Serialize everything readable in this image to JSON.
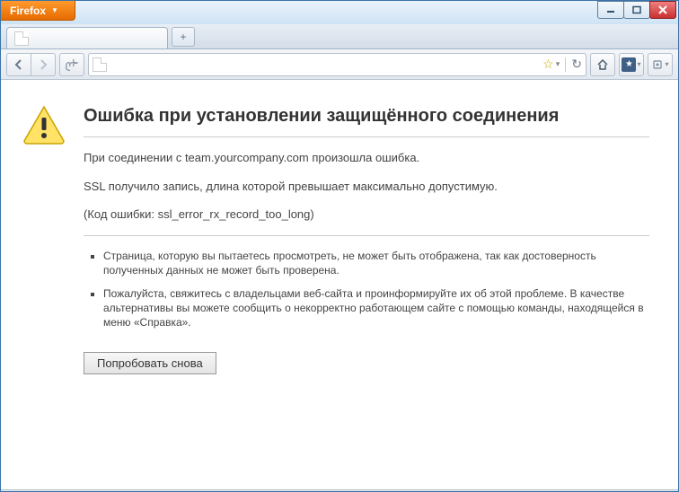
{
  "window": {
    "app_button": "Firefox",
    "tab_title": "",
    "controls": {
      "minimize": "–",
      "maximize": "□",
      "close": "×"
    }
  },
  "toolbar": {
    "back": "‹",
    "forward": "›",
    "url_value": "",
    "star": "★",
    "reload": "↻",
    "home": "⌂",
    "bookmarks": "★",
    "extensions": "⚙"
  },
  "error": {
    "title": "Ошибка при установлении защищённого соединения",
    "line1": "При соединении с team.yourcompany.com произошла ошибка.",
    "line2": "SSL получило запись, длина которой превышает максимально допустимую.",
    "code_line": "(Код ошибки: ssl_error_rx_record_too_long)",
    "bullets": [
      "Страница, которую вы пытаетесь просмотреть, не может быть отображена, так как достоверность полученных данных не может быть проверена.",
      "Пожалуйста, свяжитесь с владельцами веб-сайта и проинформируйте их об этой проблеме. В качестве альтернативы вы можете сообщить о некорректно работающем сайте с помощью команды, находящейся в меню «Справка»."
    ],
    "retry_label": "Попробовать снова"
  }
}
